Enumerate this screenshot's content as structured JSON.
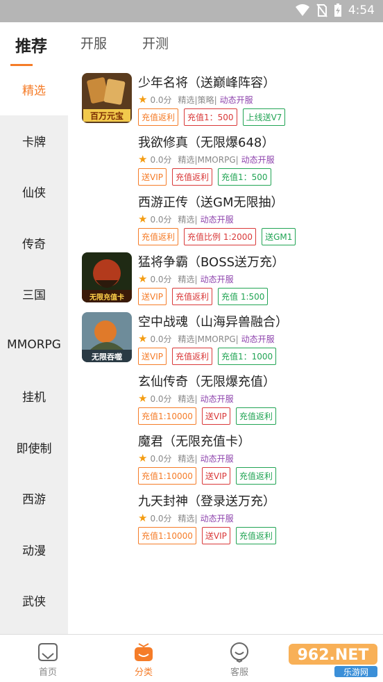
{
  "status": {
    "time": "4:54"
  },
  "tabs": [
    {
      "label": "推荐",
      "active": true
    },
    {
      "label": "开服",
      "active": false
    },
    {
      "label": "开测",
      "active": false
    }
  ],
  "sidebar": [
    {
      "label": "精选",
      "active": true
    },
    {
      "label": "卡牌"
    },
    {
      "label": "仙侠"
    },
    {
      "label": "传奇"
    },
    {
      "label": "三国"
    },
    {
      "label": "MMORPG"
    },
    {
      "label": "挂机"
    },
    {
      "label": "即使制"
    },
    {
      "label": "西游"
    },
    {
      "label": "动漫"
    },
    {
      "label": "武侠"
    }
  ],
  "games": [
    {
      "title": "少年名将（送巅峰阵容）",
      "score": "0.0分",
      "category": "精选|策略|",
      "dynamic": "动态开服",
      "thumb_text": "百万元宝",
      "tags": [
        {
          "text": "充值返利",
          "color": "orange"
        },
        {
          "text": "充值1：500",
          "color": "red"
        },
        {
          "text": "上线送V7",
          "color": "green"
        }
      ]
    },
    {
      "title": "我欲修真（无限爆648）",
      "score": "0.0分",
      "category": "精选|MMORPG|",
      "dynamic": "动态开服",
      "tags": [
        {
          "text": "送VIP",
          "color": "orange"
        },
        {
          "text": "充值返利",
          "color": "red"
        },
        {
          "text": "充值1：500",
          "color": "green"
        }
      ]
    },
    {
      "title": "西游正传（送GM无限抽）",
      "score": "0.0分",
      "category": "精选|",
      "dynamic": "动态开服",
      "tags": [
        {
          "text": "充值返利",
          "color": "orange"
        },
        {
          "text": "充值比例 1:2000",
          "color": "red"
        },
        {
          "text": "送GM1",
          "color": "green"
        }
      ]
    },
    {
      "title": "猛将争霸（BOSS送万充）",
      "score": "0.0分",
      "category": "精选|",
      "dynamic": "动态开服",
      "thumb_text": "无限充值卡",
      "tags": [
        {
          "text": "送VIP",
          "color": "orange"
        },
        {
          "text": "充值返利",
          "color": "red"
        },
        {
          "text": "充值 1:500",
          "color": "green"
        }
      ]
    },
    {
      "title": "空中战魂（山海异兽融合）",
      "score": "0.0分",
      "category": "精选|MMORPG|",
      "dynamic": "动态开服",
      "thumb_text": "无限吞噬",
      "tags": [
        {
          "text": "送VIP",
          "color": "orange"
        },
        {
          "text": "充值返利",
          "color": "red"
        },
        {
          "text": "充值1：1000",
          "color": "green"
        }
      ]
    },
    {
      "title": "玄仙传奇（无限爆充值）",
      "score": "0.0分",
      "category": "精选|",
      "dynamic": "动态开服",
      "tags": [
        {
          "text": "充值1:10000",
          "color": "orange"
        },
        {
          "text": "送VIP",
          "color": "red"
        },
        {
          "text": "充值返利",
          "color": "green"
        }
      ]
    },
    {
      "title": "魔君（无限充值卡）",
      "score": "0.0分",
      "category": "精选|",
      "dynamic": "动态开服",
      "tags": [
        {
          "text": "充值1:10000",
          "color": "orange"
        },
        {
          "text": "送VIP",
          "color": "red"
        },
        {
          "text": "充值返利",
          "color": "green"
        }
      ]
    },
    {
      "title": "九天封神（登录送万充）",
      "score": "0.0分",
      "category": "精选|",
      "dynamic": "动态开服",
      "tags": [
        {
          "text": "充值1:10000",
          "color": "orange"
        },
        {
          "text": "送VIP",
          "color": "red"
        },
        {
          "text": "充值返利",
          "color": "green"
        }
      ]
    }
  ],
  "bottom_nav": [
    {
      "label": "首页",
      "icon": "home-icon",
      "active": false
    },
    {
      "label": "分类",
      "icon": "category-icon",
      "active": true
    },
    {
      "label": "客服",
      "icon": "service-icon",
      "active": false
    }
  ],
  "watermark": {
    "text": "962.NET",
    "sub": "乐游网"
  },
  "colors": {
    "accent": "#f57c28",
    "red": "#d93838",
    "green": "#21a454",
    "purple": "#8e44ad"
  }
}
